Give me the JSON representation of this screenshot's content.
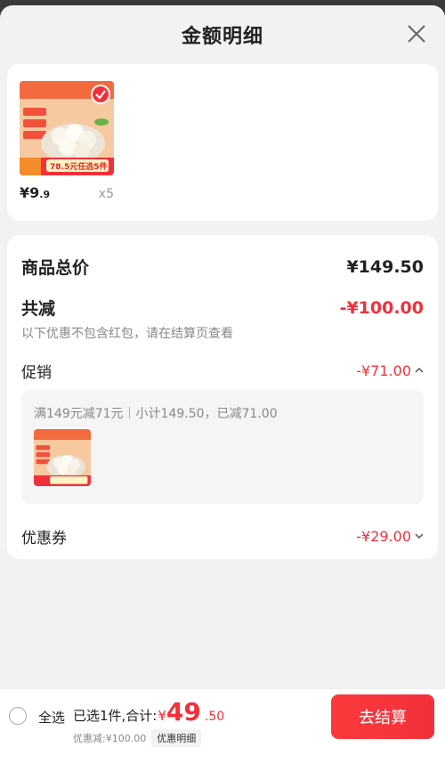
{
  "header": {
    "title": "金额明细"
  },
  "products": [
    {
      "image_text": "78.5元任选5件",
      "price_main": "¥9",
      "price_decimal": ".9",
      "quantity": "x5",
      "selected": true
    }
  ],
  "summary": {
    "total_label": "商品总价",
    "total_value": "¥149.50",
    "reduce_label": "共减",
    "reduce_value": "-¥100.00",
    "reduce_hint": "以下优惠不包含红包，请在结算页查看",
    "promo_label": "促销",
    "promo_value": "-¥71.00",
    "promo_detail": "满149元减71元｜小计149.50，已减71.00",
    "coupon_label": "优惠券",
    "coupon_value": "-¥29.00"
  },
  "bottom": {
    "select_all": "全选",
    "selected_text": "已选1件,合计:",
    "currency": "¥",
    "amount_int": "49",
    "amount_dec": ".50",
    "discount_text": "优惠减:¥100.00",
    "detail_tag": "优惠明细",
    "checkout_label": "去结算"
  },
  "colors": {
    "accent": "#f2303b",
    "sheet_bg": "#f2f2f2",
    "overlay": "#3a3a3a"
  },
  "icons": {
    "close": "close-icon",
    "check": "check-icon",
    "chevron_up": "chevron-up-icon",
    "chevron_down": "chevron-down-icon"
  }
}
